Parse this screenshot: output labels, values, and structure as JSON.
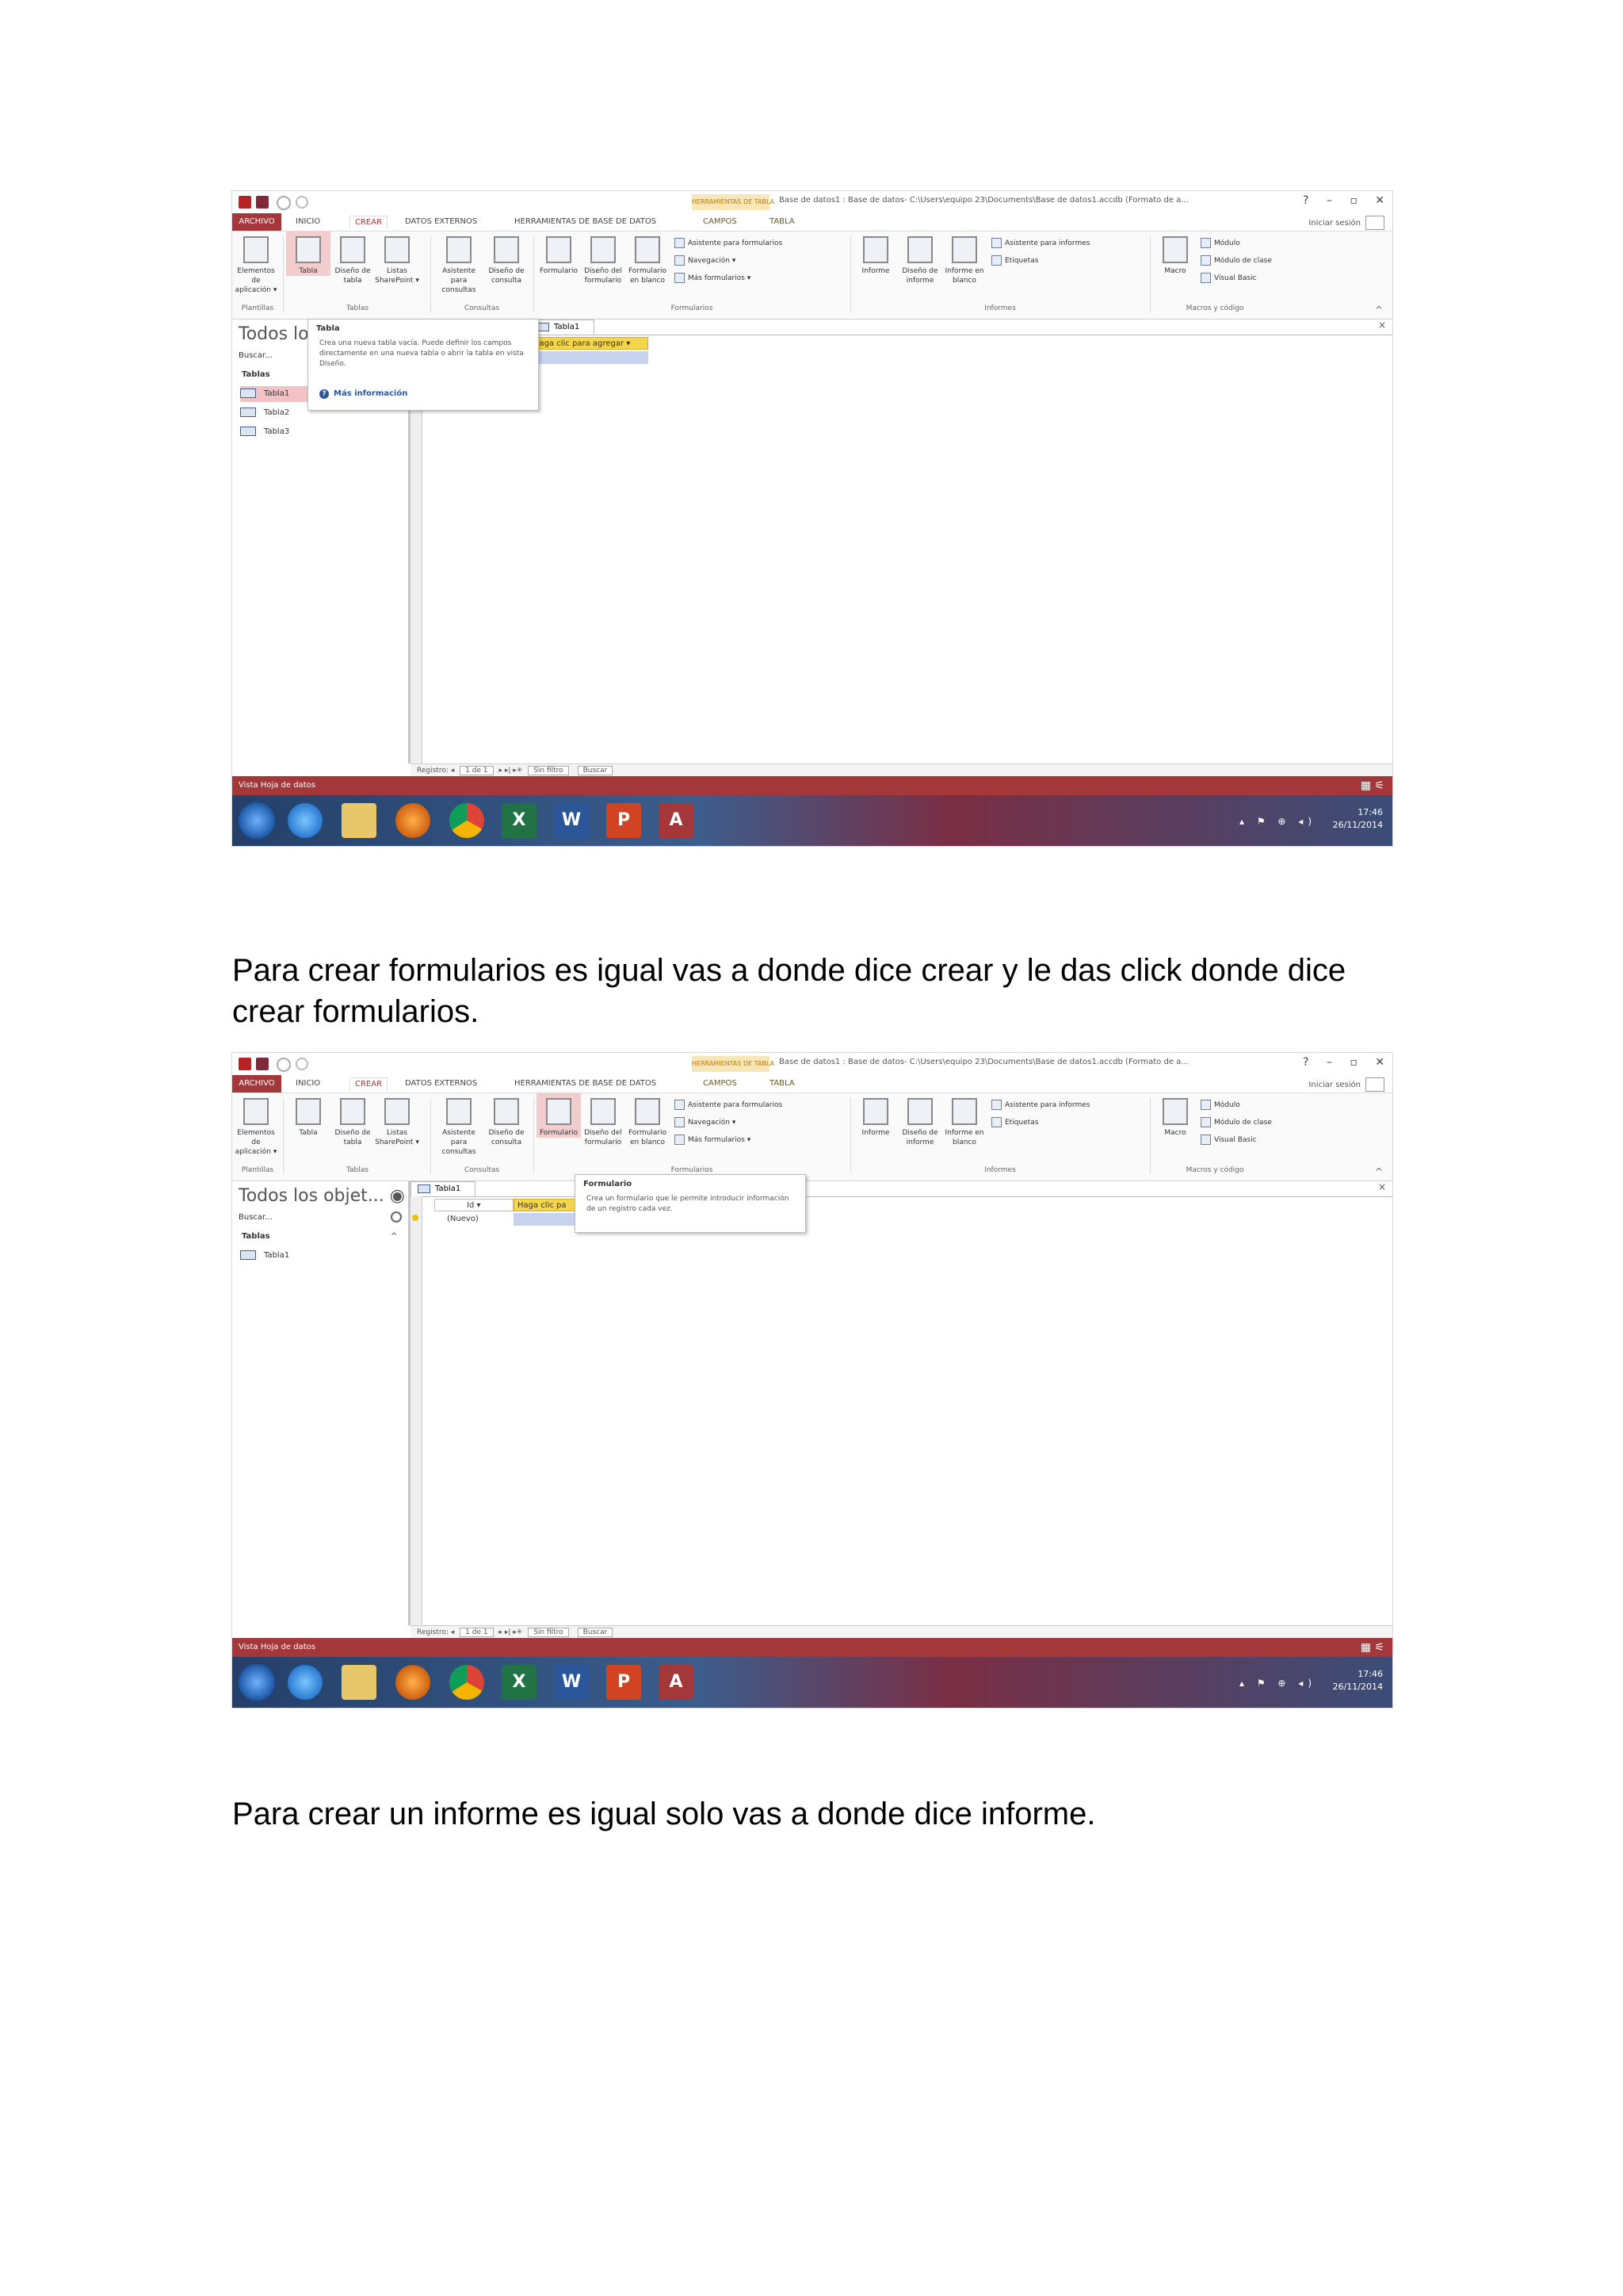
{
  "paragraphs": {
    "p1": "Para crear formularios es igual vas a donde dice crear y le das click donde dice crear formularios.",
    "p2": "Para crear un informe es igual solo vas a donde dice informe."
  },
  "colors": {
    "access_red": "#a4373a",
    "context_tab": "#f7e6b8",
    "highlight": "#f3cccd",
    "selected_column": "#f5d54a"
  },
  "window": {
    "context_tab_title": "HERRAMIENTAS DE TABLA",
    "title": "Base de datos1 : Base de datos- C:\\Users\\equipo 23\\Documents\\Base de datos1.accdb (Formato de a...",
    "controls": "? – ▫ ✕",
    "sign_in": "Iniciar sesión"
  },
  "tabs": {
    "archivo": "ARCHIVO",
    "inicio": "INICIO",
    "crear": "CREAR",
    "externos": "DATOS EXTERNOS",
    "herramientas": "HERRAMIENTAS DE BASE DE DATOS",
    "campos": "CAMPOS",
    "tabla": "TABLA"
  },
  "ribbon": {
    "elementos": "Elementos de aplicación ▾",
    "tabla": "Tabla",
    "diseno_tabla": "Diseño de tabla",
    "listas": "Listas SharePoint ▾",
    "asistente_consultas": "Asistente para consultas",
    "diseno_consulta": "Diseño de consulta",
    "formulario": "Formulario",
    "diseno_formulario": "Diseño del formulario",
    "formulario_blanco": "Formulario en blanco",
    "asistente_formularios": "Asistente para formularios",
    "navegacion": "Navegación ▾",
    "mas_formularios": "Más formularios ▾",
    "informe": "Informe",
    "diseno_informe": "Diseño de informe",
    "informe_blanco": "Informe en blanco",
    "asistente_informes": "Asistente para informes",
    "etiquetas": "Etiquetas",
    "macro": "Macro",
    "modulo": "Módulo",
    "modulo_clase": "Módulo de clase",
    "visual_basic": "Visual Basic",
    "groups": {
      "plantillas": "Plantillas",
      "tablas": "Tablas",
      "consultas": "Consultas",
      "formularios": "Formularios",
      "informes": "Informes",
      "macros": "Macros y código"
    },
    "collapse": "^"
  },
  "nav": {
    "title_short": "Todos lo",
    "title_full": "Todos los objet... ◉ «",
    "search": "Buscar...",
    "category": "Tablas",
    "category_toggle": "^",
    "items_shot1": [
      "Tabla1",
      "Tabla2",
      "Tabla3"
    ],
    "items_shot2": [
      "Tabla1"
    ]
  },
  "doc": {
    "tab_label": "Tabla1",
    "close": "×",
    "col_id": "Id ▾",
    "col_add": "Haga clic para agregar ▾",
    "col_add_partial": "Haga clic pa",
    "new_row": "(Nuevo)"
  },
  "recbar": {
    "label": "Registro:",
    "first": "◂",
    "position": "1 de 1",
    "next": "▸ ▸| ▸✳",
    "filter": "Sin filtro",
    "search": "Buscar"
  },
  "status": {
    "text": "Vista Hoja de datos",
    "icons": "▦ ⚟"
  },
  "taskbar": {
    "excel": "X",
    "word": "W",
    "ppt": "P",
    "access": "A",
    "time": "17:46",
    "date": "26/11/2014",
    "tray_icons": "▴ ⚑ ⊕ ◂)"
  },
  "tooltips": {
    "tabla": {
      "title": "Tabla",
      "text": "Crea una nueva tabla vacía. Puede definir los campos directamente en una nueva tabla o abrir la tabla en vista Diseño.",
      "help_icon": "?",
      "help": "Más información"
    },
    "formulario": {
      "title": "Formulario",
      "text": "Crea un formulario que le permite introducir información de un registro cada vez."
    }
  }
}
